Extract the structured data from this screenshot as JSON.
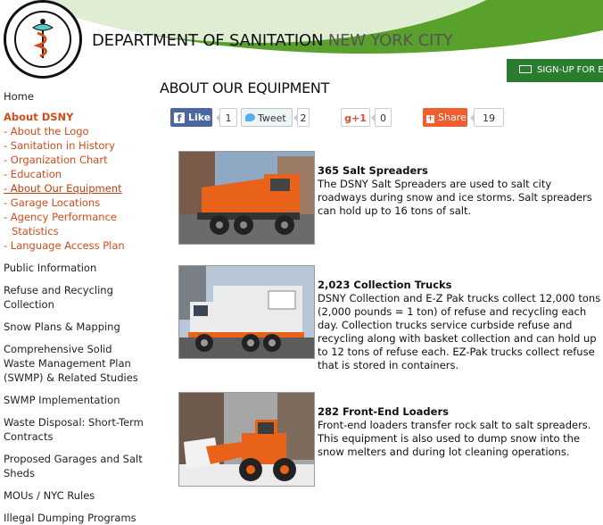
{
  "header": {
    "seal_text_top": "THE CITY OF NEW YORK",
    "seal_text_bottom": "DEPARTMENT of SANITATION",
    "title_main": "DEPARTMENT OF SANITATION",
    "title_city": "NEW YORK CITY",
    "signup_label": "SIGN-UP FOR EM"
  },
  "sidebar": {
    "home": "Home",
    "current_section": "About DSNY",
    "sub_items": [
      "- About the Logo",
      "- Sanitation in History",
      "- Organization Chart",
      "- Education",
      "- About Our Equipment",
      "- Garage Locations",
      "- Agency Performance"
    ],
    "sub_item_cont": "Statistics",
    "sub_item_last": "- Language Access Plan",
    "sections": [
      "Public Information",
      "Refuse and Recycling Collection",
      "Snow Plans & Mapping",
      "Comprehensive Solid Waste Management Plan (SWMP) & Related Studies",
      "SWMP Implementation",
      "Waste Disposal: Short-Term Contracts",
      "Proposed Garages and Salt Sheds",
      "MOUs / NYC Rules",
      "Illegal Dumping Programs"
    ]
  },
  "main": {
    "title": "ABOUT OUR EQUIPMENT",
    "social": {
      "facebook_label": "Like",
      "facebook_icon": "f",
      "facebook_count": "1",
      "twitter_label": "Tweet",
      "twitter_count": "2",
      "gplus_label": "g+1",
      "gplus_count": "0",
      "share_label": "Share",
      "share_icon": "+",
      "share_count": "19"
    },
    "equipment": [
      {
        "name": "365 Salt Spreaders",
        "description": "The DSNY Salt Spreaders are used to salt city roadways during snow and ice storms.  Salt spreaders can hold up to 16 tons of salt."
      },
      {
        "name": "2,023 Collection Trucks",
        "description": "DSNY Collection and E-Z Pak trucks collect 12,000 tons (2,000 pounds = 1 ton) of refuse and recycling each day.  Collection trucks service curbside refuse and recycling along with basket collection and can hold up to 12 tons of refuse each.  EZ-Pak trucks collect refuse that is stored in containers."
      },
      {
        "name": "282 Front-End Loaders",
        "description": "Front-end loaders transfer rock salt to salt spreaders. This equipment is also used to dump snow into the snow melters and during lot cleaning operations."
      }
    ]
  },
  "colors": {
    "header_green": "#5aa02c",
    "header_light": "#dfeed3",
    "signup_green": "#2a7d2e",
    "nav_orange": "#d54b17",
    "facebook_blue": "#4b67a1",
    "share_orange": "#f05d2e"
  }
}
